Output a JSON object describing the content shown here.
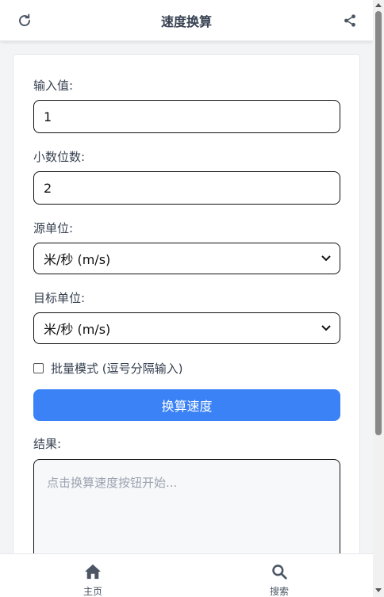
{
  "header": {
    "title": "速度换算",
    "left_icon": "refresh-icon",
    "right_icon": "share-icon"
  },
  "form": {
    "input_label": "输入值:",
    "input_value": "1",
    "decimals_label": "小数位数:",
    "decimals_value": "2",
    "source_label": "源单位:",
    "source_value": "米/秒 (m/s)",
    "target_label": "目标单位:",
    "target_value": "米/秒 (m/s)",
    "batch_label": "批量模式 (逗号分隔输入)",
    "batch_checked": false,
    "convert_button": "换算速度",
    "result_label": "结果:",
    "result_placeholder": "点击换算速度按钮开始..."
  },
  "tabbar": {
    "home_label": "主页",
    "home_icon": "home-icon",
    "search_label": "搜索",
    "search_icon": "search-icon"
  },
  "colors": {
    "accent": "#3b82f6",
    "background": "#f3f4f6"
  }
}
